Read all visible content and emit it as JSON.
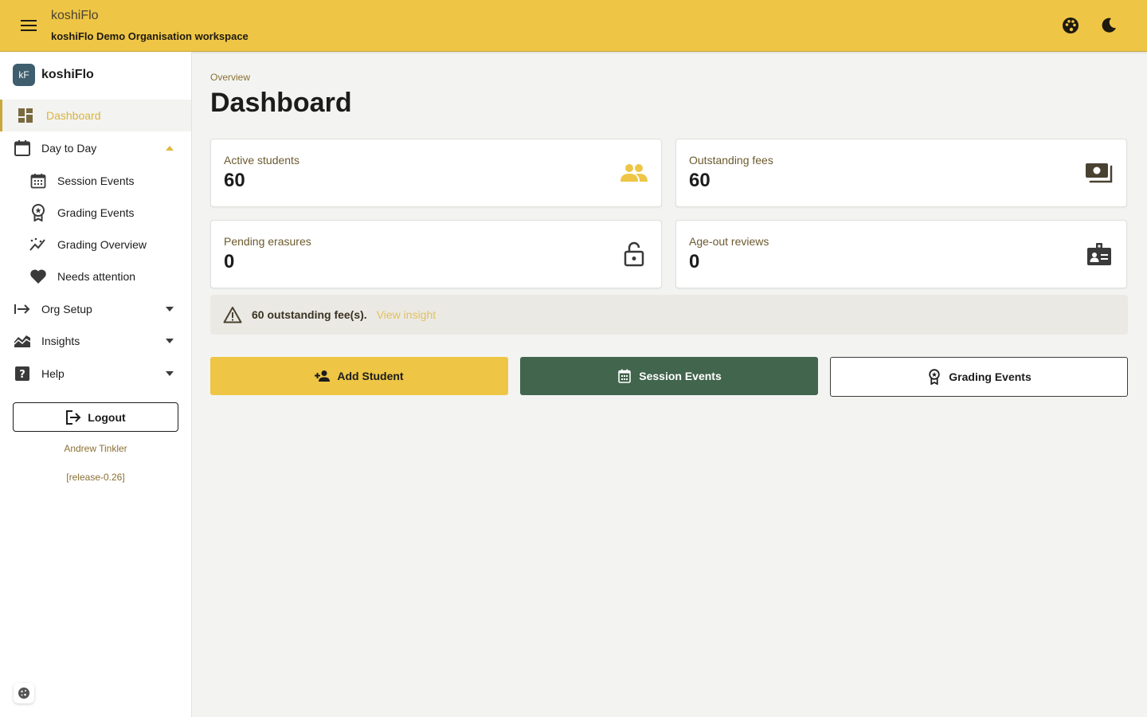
{
  "app": {
    "title": "koshiFlo",
    "workspace": "koshiFlo Demo Organisation workspace"
  },
  "colors": {
    "accent": "#eec545",
    "primary_dark": "#42654d",
    "muted_brown": "#8a7033"
  },
  "sidebar": {
    "brand_logo": "kF",
    "brand_name": "koshiFlo",
    "items": [
      {
        "label": "Dashboard",
        "icon": "dashboard-icon",
        "active": true
      },
      {
        "label": "Day to Day",
        "icon": "calendar-icon",
        "expanded": true
      },
      {
        "label": "Session Events",
        "icon": "calendar-grid-icon",
        "sub": true
      },
      {
        "label": "Grading Events",
        "icon": "award-icon",
        "sub": true
      },
      {
        "label": "Grading Overview",
        "icon": "chart-line-icon",
        "sub": true
      },
      {
        "label": "Needs attention",
        "icon": "heart-icon",
        "sub": true
      },
      {
        "label": "Org Setup",
        "icon": "arrow-right-bar-icon",
        "expanded": false
      },
      {
        "label": "Insights",
        "icon": "insights-icon",
        "expanded": false
      },
      {
        "label": "Help",
        "icon": "help-icon",
        "expanded": false
      }
    ],
    "logout_label": "Logout",
    "user_name": "Andrew Tinkler",
    "release": "[release-0.26]"
  },
  "main": {
    "breadcrumb": "Overview",
    "title": "Dashboard",
    "cards": [
      {
        "label": "Active students",
        "value": "60",
        "icon": "people-icon"
      },
      {
        "label": "Outstanding fees",
        "value": "60",
        "icon": "cash-icon"
      },
      {
        "label": "Pending erasures",
        "value": "0",
        "icon": "lock-open-icon"
      },
      {
        "label": "Age-out reviews",
        "value": "0",
        "icon": "id-badge-icon"
      }
    ],
    "alert": {
      "text": "60 outstanding fee(s).",
      "link": "View insight"
    },
    "actions": {
      "add_student": "Add Student",
      "session_events": "Session Events",
      "grading_events": "Grading Events"
    }
  }
}
